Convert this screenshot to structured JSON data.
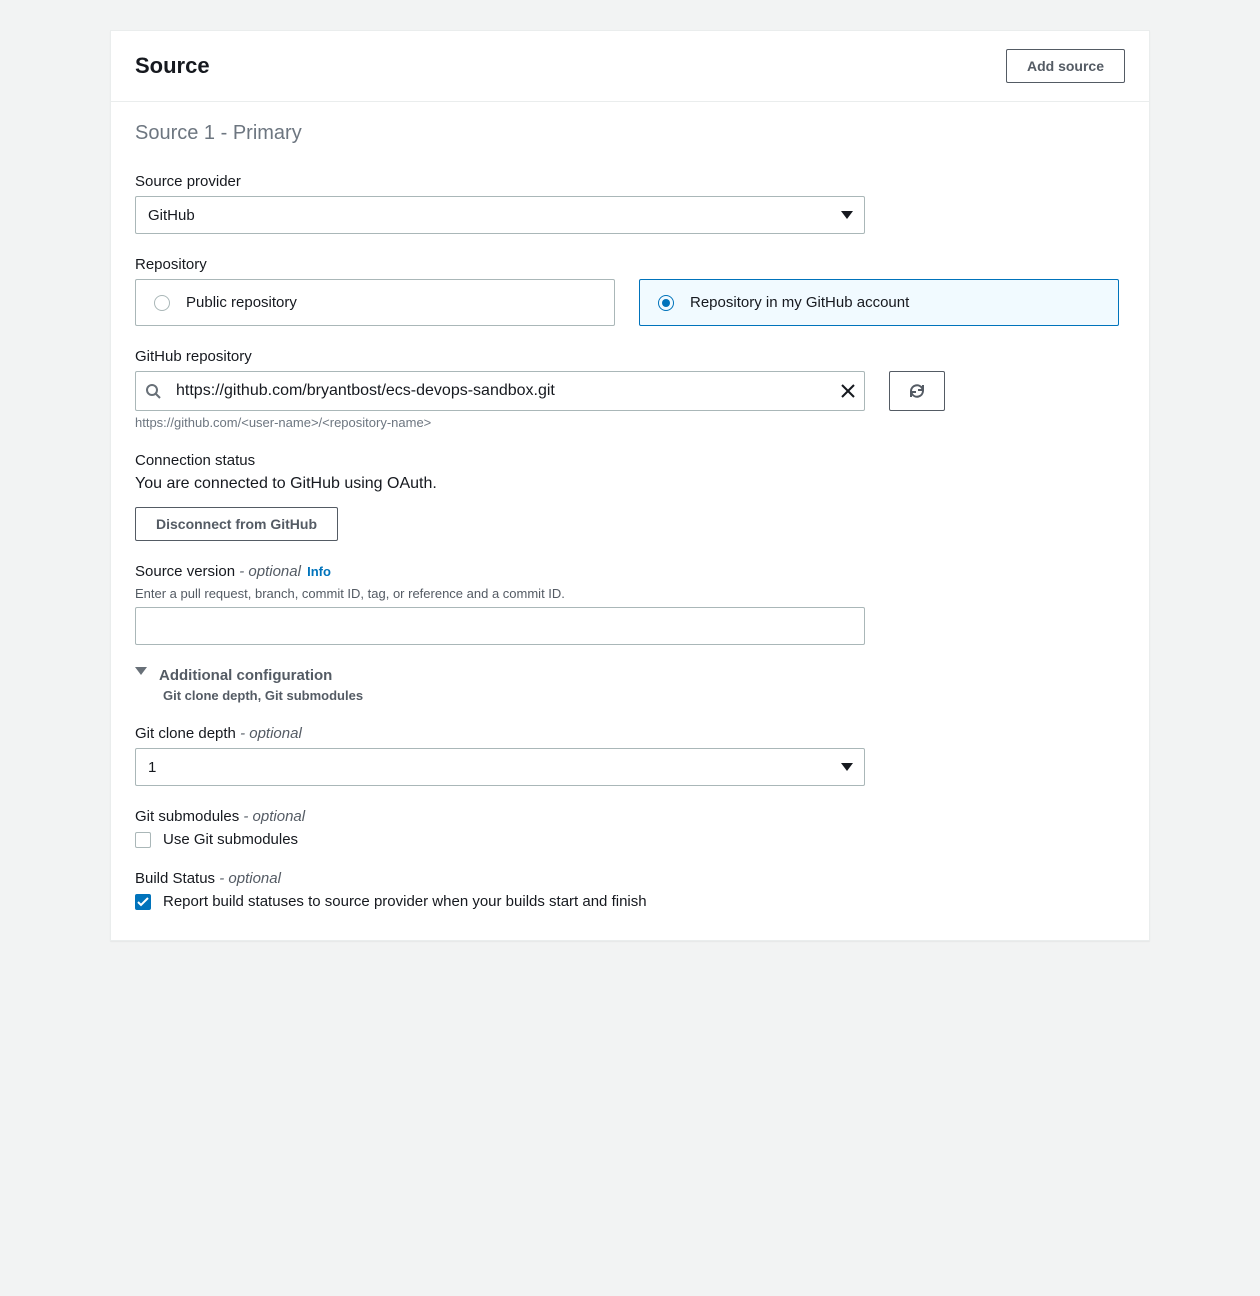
{
  "header": {
    "title": "Source",
    "add_button": "Add source"
  },
  "section_title": "Source 1 - Primary",
  "source_provider": {
    "label": "Source provider",
    "value": "GitHub"
  },
  "repository": {
    "label": "Repository",
    "options": {
      "public": "Public repository",
      "my_account": "Repository in my GitHub account"
    },
    "selected": "my_account"
  },
  "github_repo": {
    "label": "GitHub repository",
    "value": "https://github.com/bryantbost/ecs-devops-sandbox.git",
    "hint": "https://github.com/<user-name>/<repository-name>"
  },
  "connection": {
    "label": "Connection status",
    "text": "You are connected to GitHub using OAuth.",
    "disconnect_button": "Disconnect from GitHub"
  },
  "source_version": {
    "label": "Source version",
    "optional": "- optional",
    "info": "Info",
    "desc": "Enter a pull request, branch, commit ID, tag, or reference and a commit ID.",
    "value": ""
  },
  "additional_config": {
    "title": "Additional configuration",
    "subtitle": "Git clone depth, Git submodules"
  },
  "git_clone_depth": {
    "label": "Git clone depth",
    "optional": "- optional",
    "value": "1"
  },
  "git_submodules": {
    "label": "Git submodules",
    "optional": "- optional",
    "checkbox_label": "Use Git submodules",
    "checked": false
  },
  "build_status": {
    "label": "Build Status",
    "optional": "- optional",
    "checkbox_label": "Report build statuses to source provider when your builds start and finish",
    "checked": true
  }
}
